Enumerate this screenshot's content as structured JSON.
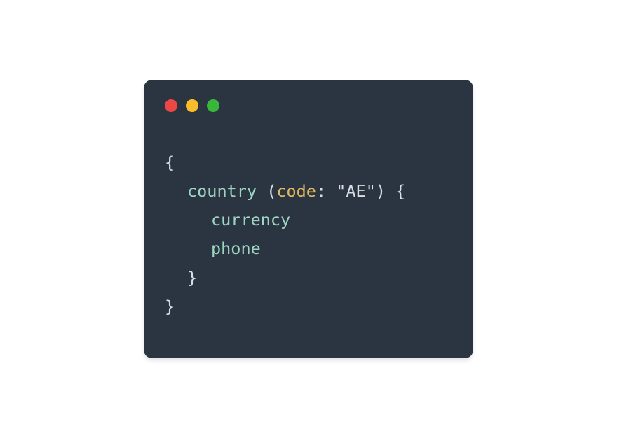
{
  "window": {
    "controls": {
      "close": "close",
      "minimize": "minimize",
      "maximize": "maximize"
    }
  },
  "code": {
    "braceOpen": "{",
    "braceClose": "}",
    "field1": "country",
    "sp1": " ",
    "parenOpen": "(",
    "arg1": "code",
    "colon": ":",
    "sp2": " ",
    "str1": "\"AE\"",
    "parenClose": ")",
    "sp3": " ",
    "innerBraceOpen": "{",
    "field2": "currency",
    "field3": "phone",
    "innerBraceClose": "}"
  }
}
